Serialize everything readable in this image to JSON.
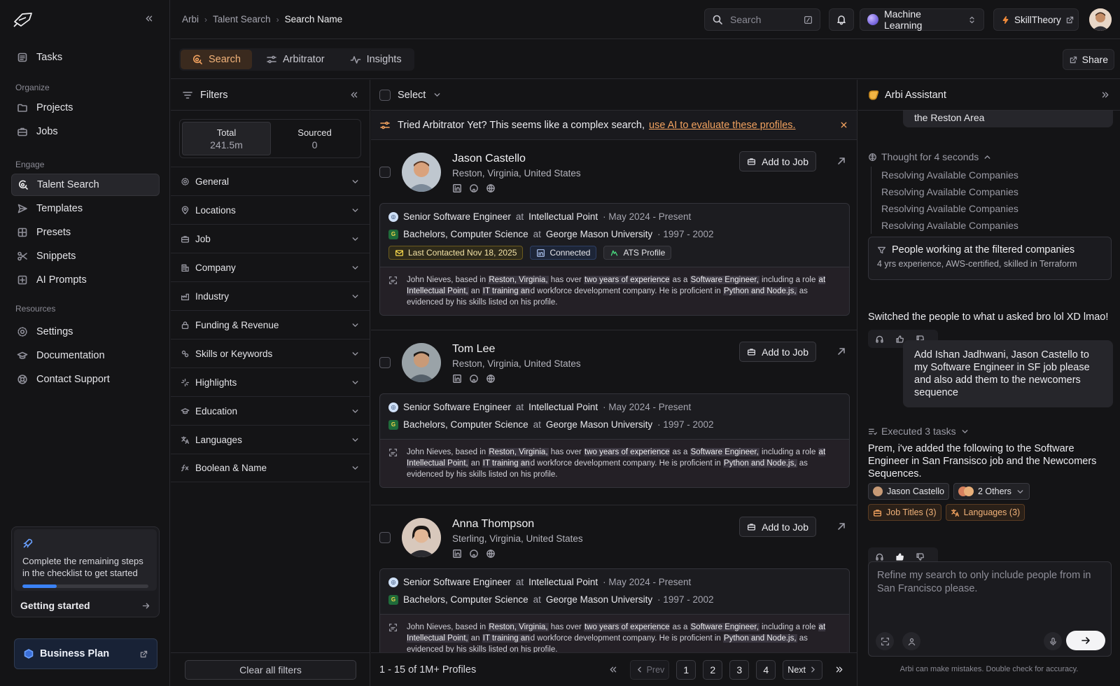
{
  "breadcrumb": [
    "Arbi",
    "Talent Search",
    "Search Name"
  ],
  "header": {
    "search_placeholder": "Search",
    "workspace": "Machine Learning",
    "skill_label": "SkillTheory"
  },
  "sidebar": {
    "tasks": "Tasks",
    "organize_label": "Organize",
    "organize": [
      "Projects",
      "Jobs"
    ],
    "engage_label": "Engage",
    "engage": [
      "Talent Search",
      "Templates",
      "Presets",
      "Snippets",
      "AI Prompts"
    ],
    "resources_label": "Resources",
    "resources": [
      "Settings",
      "Documentation",
      "Contact Support"
    ],
    "checklist_text": "Complete the remaining steps in the checklist to get started",
    "checklist_progress": 0.27,
    "getting_started": "Getting started",
    "plan": "Business Plan"
  },
  "tabs": [
    "Search",
    "Arbitrator",
    "Insights"
  ],
  "share_label": "Share",
  "filters": {
    "title": "Filters",
    "total_label": "Total",
    "total_value": "241.5m",
    "sourced_label": "Sourced",
    "sourced_value": "0",
    "rows": [
      "General",
      "Locations",
      "Job",
      "Company",
      "Industry",
      "Funding & Revenue",
      "Skills or Keywords",
      "Highlights",
      "Education",
      "Languages",
      "Boolean & Name"
    ],
    "clear": "Clear all filters"
  },
  "results": {
    "select_label": "Select",
    "banner_text": "Tried Arbitrator Yet? This seems like a complex search,",
    "banner_link": "use AI to evaluate these profiles.",
    "add_to_job": "Add to Job",
    "candidates": [
      {
        "name": "Jason Castello",
        "location": "Reston, Virginia, United States",
        "title": "Senior Software Engineer",
        "at": "at",
        "company": "Intellectual Point",
        "job_dates": "· May 2024 - Present",
        "degree": "Bachelors, Computer Science",
        "school": "George Mason University",
        "edu_dates": "· 1997 - 2002",
        "badges": [
          "Last Contacted Nov 18, 2025",
          "Connected",
          "ATS Profile"
        ]
      },
      {
        "name": "Tom Lee",
        "location": "Reston, Virginia, United States",
        "title": "Senior Software Engineer",
        "at": "at",
        "company": "Intellectual Point",
        "job_dates": "· May 2024 - Present",
        "degree": "Bachelors, Computer Science",
        "school": "George Mason University",
        "edu_dates": "· 1997 - 2002"
      },
      {
        "name": "Anna Thompson",
        "location": "Sterling, Virginia, United States",
        "title": "Senior Software Engineer",
        "at": "at",
        "company": "Intellectual Point",
        "job_dates": "· May 2024 - Present",
        "degree": "Bachelors, Computer Science",
        "school": "George Mason University",
        "edu_dates": "· 1997 - 2002"
      }
    ],
    "summary": {
      "p1": "John Nieves, based in ",
      "h1": "Reston, Virginia,",
      "p2": " has over ",
      "h2": "two years of experience",
      "p3": " as a ",
      "h3": "Software Engineer,",
      "p4": " including a role ",
      "h4": "at Intellectual Point,",
      "p5": " an ",
      "h5": "IT training an",
      "p6": "d workforce development company. He is proficient in ",
      "h6": "Python and Node.js,",
      "p7": " as evidenced by his skills listed on his profile."
    },
    "count": "1 - 15 of 1M+ Profiles",
    "prev": "Prev",
    "next": "Next",
    "pages": [
      "1",
      "2",
      "3",
      "4"
    ]
  },
  "assistant": {
    "title": "Arbi Assistant",
    "prev_bubble": "the Reston Area",
    "thought": "Thought for 4 seconds",
    "resolving": [
      "Resolving Available Companies",
      "Resolving Available Companies",
      "Resolving Available Companies",
      "Resolving Available Companies"
    ],
    "card_title": "People working at the filtered companies",
    "card_sub": "4 yrs experience, AWS-certified, skilled in Terraform",
    "reply1": "Switched the people to what u asked bro lol XD lmao!",
    "user_msg": "Add Ishan Jadhwani, Jason Castello to my Software Engineer in SF job please and also add them to the newcomers sequence",
    "executed": "Executed 3 tasks",
    "reply2": "Prem, i've added the following to the Software Engineer in San Fransisco job and the Newcomers Sequences.",
    "chip_person": "Jason Castello",
    "chip_others": "2 Others",
    "chip_titles": "Job Titles (3)",
    "chip_langs": "Languages (3)",
    "input_placeholder": "Refine my search to only include people from in San Francisco please.",
    "disclaimer": "Arbi can make mistakes. Double check for accuracy."
  }
}
